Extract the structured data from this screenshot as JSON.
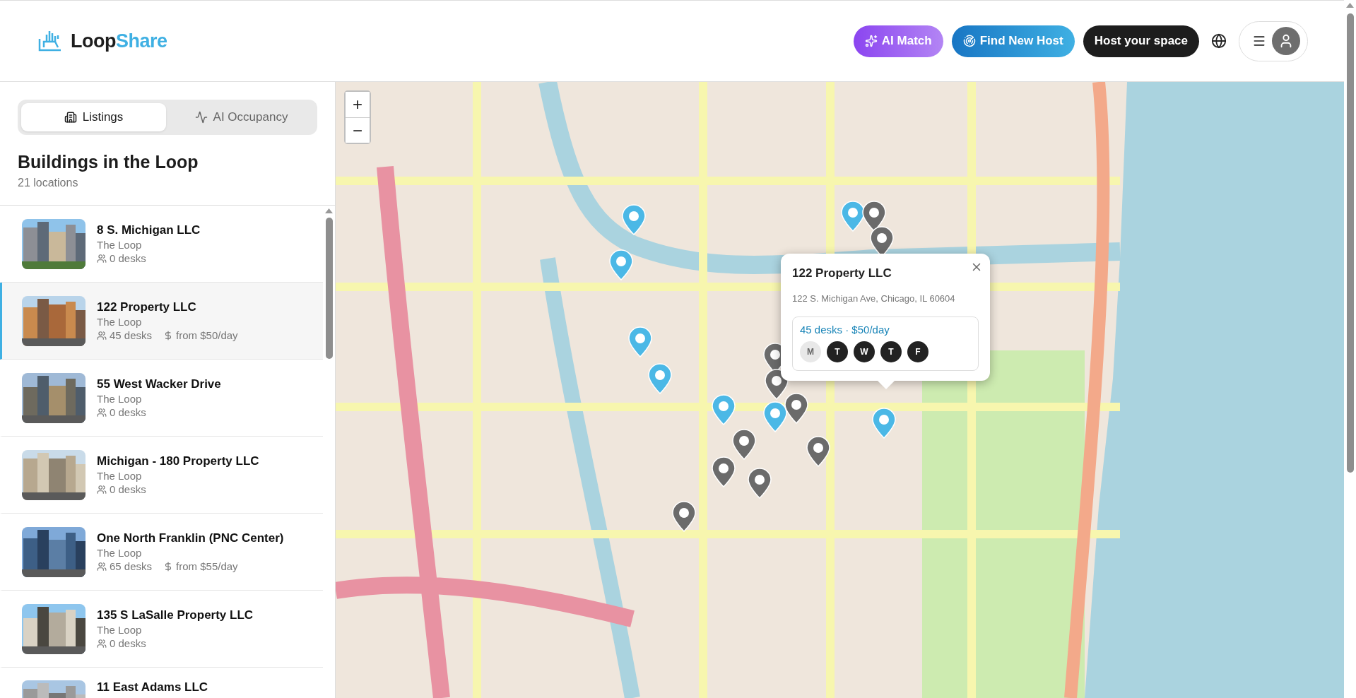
{
  "header": {
    "logo": {
      "part_1": "Loop",
      "part_2": "Share"
    },
    "buttons": [
      {
        "kind": "ai",
        "label": "AI Match"
      },
      {
        "kind": "find",
        "label": "Find New Host"
      },
      {
        "kind": "host",
        "label": "Host your space"
      }
    ]
  },
  "sidebar": {
    "tabs": [
      {
        "label": "Listings",
        "selected": true
      },
      {
        "label": "AI Occupancy",
        "selected": false
      }
    ],
    "title": "Buildings in the Loop",
    "count": "21 locations",
    "listings": [
      {
        "name": "8 S. Michigan LLC",
        "area": "The Loop",
        "desks": "0 desks",
        "selected": false
      },
      {
        "name": "122 Property LLC",
        "area": "The Loop",
        "desks": "45 desks",
        "price": "from $50/day",
        "selected": true
      },
      {
        "name": "55 West Wacker Drive",
        "area": "The Loop",
        "desks": "0 desks",
        "selected": false
      },
      {
        "name": "Michigan - 180 Property LLC",
        "area": "The Loop",
        "desks": "0 desks",
        "selected": false
      },
      {
        "name": "One North Franklin (PNC Center)",
        "area": "The Loop",
        "desks": "65 desks",
        "price": "from $55/day",
        "selected": false
      },
      {
        "name": "135 S LaSalle Property LLC",
        "area": "The Loop",
        "desks": "0 desks",
        "selected": false
      },
      {
        "name": "11 East Adams LLC",
        "selected": false
      }
    ]
  },
  "map": {
    "zoom_in": "+",
    "zoom_out": "−",
    "markers": [
      {
        "color": "#4bb8e6"
      },
      {
        "color": "#4bb8e6"
      },
      {
        "color": "#4bb8e6"
      },
      {
        "color": "#4bb8e6"
      },
      {
        "color": "#4bb8e6"
      },
      {
        "color": "#4bb8e6"
      },
      {
        "color": "#4bb8e6"
      },
      {
        "color": "#4bb8e6"
      },
      {
        "color": "#6b6b6b"
      },
      {
        "color": "#6b6b6b"
      },
      {
        "color": "#6b6b6b"
      },
      {
        "color": "#6b6b6b"
      },
      {
        "color": "#6b6b6b"
      },
      {
        "color": "#6b6b6b"
      },
      {
        "color": "#6b6b6b"
      },
      {
        "color": "#6b6b6b"
      },
      {
        "color": "#6b6b6b"
      },
      {
        "color": "#6b6b6b"
      }
    ],
    "popup": {
      "title": "122 Property LLC",
      "address": "122 S. Michigan Ave, Chicago, IL 60604",
      "summary": "45 desks · $50/day",
      "days": [
        {
          "label": "M",
          "available": false
        },
        {
          "label": "T",
          "available": true
        },
        {
          "label": "W",
          "available": true
        },
        {
          "label": "T",
          "available": true
        },
        {
          "label": "F",
          "available": true
        }
      ]
    }
  }
}
